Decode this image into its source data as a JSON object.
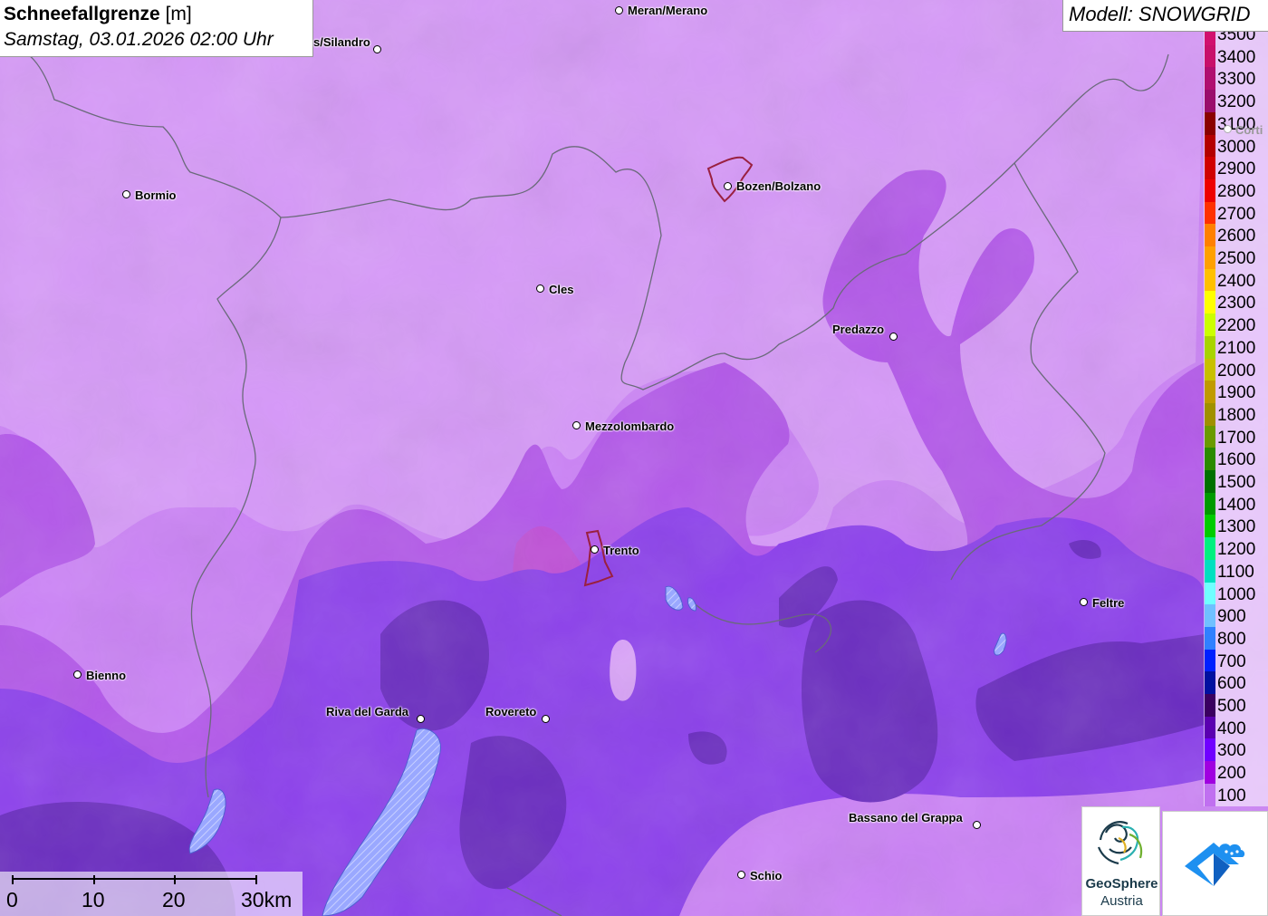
{
  "title": {
    "variable": "Schneefallgrenze",
    "unit": "[m]",
    "datetime": "Samstag, 03.01.2026 02:00 Uhr"
  },
  "model": "Modell: SNOWGRID",
  "legend": [
    {
      "label": "3500",
      "color": "#d1106e"
    },
    {
      "label": "3400",
      "color": "#c8106a"
    },
    {
      "label": "3300",
      "color": "#b00f70"
    },
    {
      "label": "3200",
      "color": "#9a0d6c"
    },
    {
      "label": "3100",
      "color": "#8a0000"
    },
    {
      "label": "3000",
      "color": "#b40000"
    },
    {
      "label": "2900",
      "color": "#d00000"
    },
    {
      "label": "2800",
      "color": "#ee0000"
    },
    {
      "label": "2700",
      "color": "#ff3000"
    },
    {
      "label": "2600",
      "color": "#ff8000"
    },
    {
      "label": "2500",
      "color": "#ffa000"
    },
    {
      "label": "2400",
      "color": "#ffc000"
    },
    {
      "label": "2300",
      "color": "#ffff00"
    },
    {
      "label": "2200",
      "color": "#ccff00"
    },
    {
      "label": "2100",
      "color": "#a8d400"
    },
    {
      "label": "2000",
      "color": "#c8c000"
    },
    {
      "label": "1900",
      "color": "#c09a00"
    },
    {
      "label": "1800",
      "color": "#a09000"
    },
    {
      "label": "1700",
      "color": "#6a9a00"
    },
    {
      "label": "1600",
      "color": "#2a8a00"
    },
    {
      "label": "1500",
      "color": "#007000"
    },
    {
      "label": "1400",
      "color": "#009a00"
    },
    {
      "label": "1300",
      "color": "#00cc00"
    },
    {
      "label": "1200",
      "color": "#00f080"
    },
    {
      "label": "1100",
      "color": "#00e0c0"
    },
    {
      "label": "1000",
      "color": "#70ffff"
    },
    {
      "label": "900",
      "color": "#70c0ff"
    },
    {
      "label": "800",
      "color": "#3080ff"
    },
    {
      "label": "700",
      "color": "#0020ff"
    },
    {
      "label": "600",
      "color": "#0010a0"
    },
    {
      "label": "500",
      "color": "#3a0060"
    },
    {
      "label": "400",
      "color": "#5a00b0"
    },
    {
      "label": "300",
      "color": "#7000ff"
    },
    {
      "label": "200",
      "color": "#a000e0"
    },
    {
      "label": "100",
      "color": "#c070f0"
    }
  ],
  "cities": [
    {
      "name": "Meran/Merano",
      "dot": [
        684,
        12
      ],
      "label": [
        693,
        4
      ],
      "side": "right"
    },
    {
      "name": "s/Silandro",
      "dot": [
        417,
        55
      ],
      "label": [
        346,
        39
      ],
      "side": "left"
    },
    {
      "name": "Bozen/Bolzano",
      "dot": [
        804,
        206
      ],
      "label": [
        813,
        198
      ],
      "side": "right"
    },
    {
      "name": "Bormio",
      "dot": [
        140,
        215
      ],
      "label": [
        149,
        208
      ],
      "side": "right"
    },
    {
      "name": "Cles",
      "dot": [
        597,
        319
      ],
      "label": [
        606,
        312
      ],
      "side": "right"
    },
    {
      "name": "Predazzo",
      "dot": [
        987,
        372
      ],
      "label": [
        919,
        356
      ],
      "side": "left"
    },
    {
      "name": "Mezzolombardo",
      "dot": [
        637,
        470
      ],
      "label": [
        646,
        463
      ],
      "side": "right"
    },
    {
      "name": "Trento",
      "dot": [
        657,
        607
      ],
      "label": [
        666,
        600
      ],
      "side": "right"
    },
    {
      "name": "Feltre",
      "dot": [
        1197,
        665
      ],
      "label": [
        1206,
        658
      ],
      "side": "right"
    },
    {
      "name": "Bienno",
      "dot": [
        86,
        745
      ],
      "label": [
        95,
        738
      ],
      "side": "right"
    },
    {
      "name": "Riva del Garda",
      "dot": [
        465,
        794
      ],
      "label": [
        360,
        778
      ],
      "side": "left"
    },
    {
      "name": "Rovereto",
      "dot": [
        603,
        794
      ],
      "label": [
        536,
        778
      ],
      "side": "left"
    },
    {
      "name": "Bassano del Grappa",
      "dot": [
        1079,
        911
      ],
      "label": [
        937,
        895
      ],
      "side": "left"
    },
    {
      "name": "Schio",
      "dot": [
        819,
        966
      ],
      "label": [
        828,
        959
      ],
      "side": "right"
    },
    {
      "name": "Corti",
      "dot": [
        1356,
        143
      ],
      "label": [
        1364,
        136
      ],
      "side": "right"
    }
  ],
  "scale": {
    "labels": [
      "0",
      "10",
      "20",
      "30km"
    ]
  },
  "logos": {
    "geosphere_line1": "GeoSphere",
    "geosphere_line2": "Austria"
  },
  "colors": {
    "base": "#c980f5",
    "mid": "#b050e8",
    "purple": "#8a3ee8",
    "blue": "#6c2ee0",
    "dark": "#5a2aa8"
  }
}
